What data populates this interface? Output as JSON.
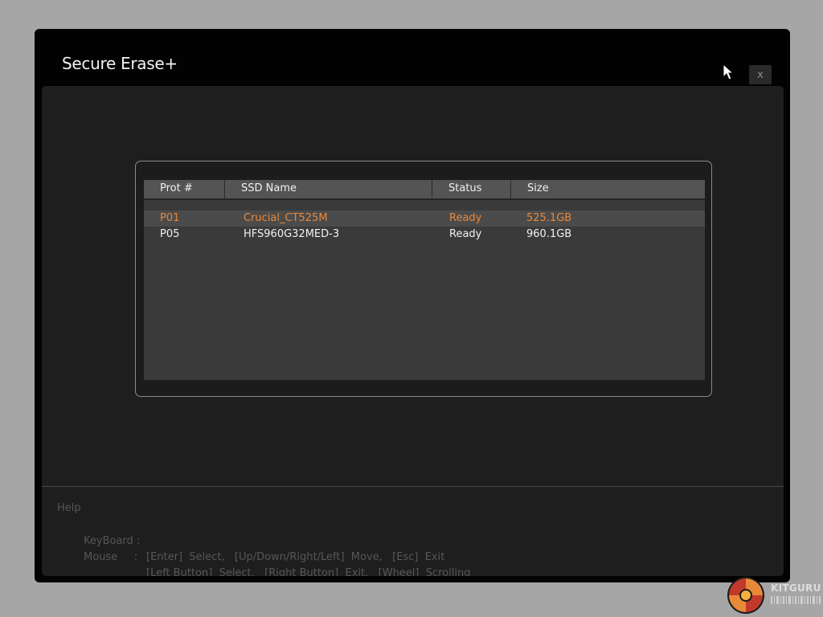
{
  "window": {
    "title": "Secure Erase+",
    "close_label": "x"
  },
  "table": {
    "columns": [
      "Prot #",
      "SSD Name",
      "Status",
      "Size"
    ],
    "rows": [
      {
        "port": "P01",
        "name": "Crucial_CT525M",
        "status": "Ready",
        "size": "525.1GB",
        "selected": true
      },
      {
        "port": "P05",
        "name": "HFS960G32MED-3",
        "status": "Ready",
        "size": "960.1GB",
        "selected": false
      }
    ]
  },
  "help": {
    "title": "Help",
    "keyboard_label": "KeyBoard :",
    "keyboard_text": "[Enter]  Select,   [Up/Down/Right/Left]  Move,   [Esc]  Exit",
    "mouse_label": "Mouse     :",
    "mouse_text": "[Left Button]  Select,   [Right Button]  Exit,   [Wheel]  Scrolling"
  },
  "watermark": {
    "text": "KITGURU",
    "colors": {
      "orange": "#e8893a",
      "red": "#c0392b"
    }
  },
  "icons": {
    "close": "close-icon",
    "cursor": "mouse-pointer-icon",
    "logo": "kitguru-logo"
  }
}
